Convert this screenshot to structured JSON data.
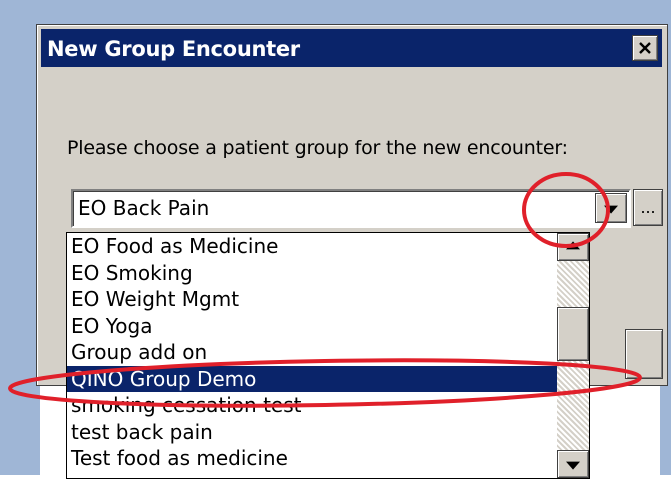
{
  "dialog": {
    "title": "New Group Encounter",
    "close_icon": "close-icon",
    "prompt": "Please choose a patient group for the new encounter:",
    "combo": {
      "selected_value": "EO Back Pain",
      "arrow_icon": "chevron-down-icon"
    },
    "browse_label": "..."
  },
  "dropdown": {
    "items": [
      "EO Food as Medicine",
      "EO Smoking",
      "EO Weight Mgmt",
      "EO Yoga",
      "Group add on",
      "QINO Group Demo",
      "smoking cessation test",
      "test back pain",
      "Test food as medicine"
    ],
    "selected_index": 5
  },
  "colors": {
    "title_bar": "#0a246a",
    "selection": "#0a246a",
    "annotation": "#e0202a",
    "window_face": "#d4d0c8",
    "background": "#9fb6d6"
  }
}
